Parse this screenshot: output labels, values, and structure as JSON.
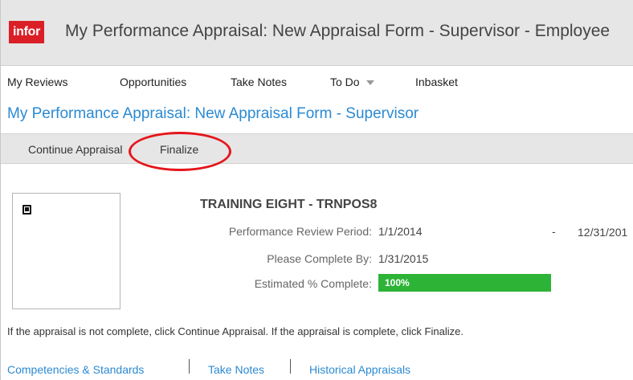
{
  "app": {
    "logo_text": "infor",
    "title": "My Performance Appraisal: New Appraisal Form - Supervisor - Employee"
  },
  "nav": {
    "items": [
      {
        "label": "My Reviews"
      },
      {
        "label": "Opportunities"
      },
      {
        "label": "Take Notes"
      },
      {
        "label": "To Do"
      },
      {
        "label": "Inbasket"
      }
    ]
  },
  "page": {
    "title": "My Performance Appraisal: New Appraisal Form - Supervisor"
  },
  "actions": {
    "continue_label": "Continue Appraisal",
    "finalize_label": "Finalize"
  },
  "employee": {
    "name": "TRAINING EIGHT - TRNPOS8",
    "review_period_label": "Performance Review Period:",
    "review_period_start": "1/1/2014",
    "review_period_separator": "-",
    "review_period_end": "12/31/201",
    "complete_by_label": "Please Complete By:",
    "complete_by_value": "1/31/2015",
    "estimated_label": "Estimated % Complete:",
    "estimated_text": "100%",
    "estimated_fraction": 1.0
  },
  "instructions": "If the appraisal is not complete, click Continue Appraisal. If the appraisal is complete, click Finalize.",
  "links": {
    "competencies": "Competencies & Standards",
    "take_notes": "Take Notes",
    "historical": "Historical Appraisals"
  },
  "colors": {
    "brand": "#da1f26",
    "link": "#2b8ad3",
    "progress": "#2db336",
    "highlight": "#e5161b"
  }
}
